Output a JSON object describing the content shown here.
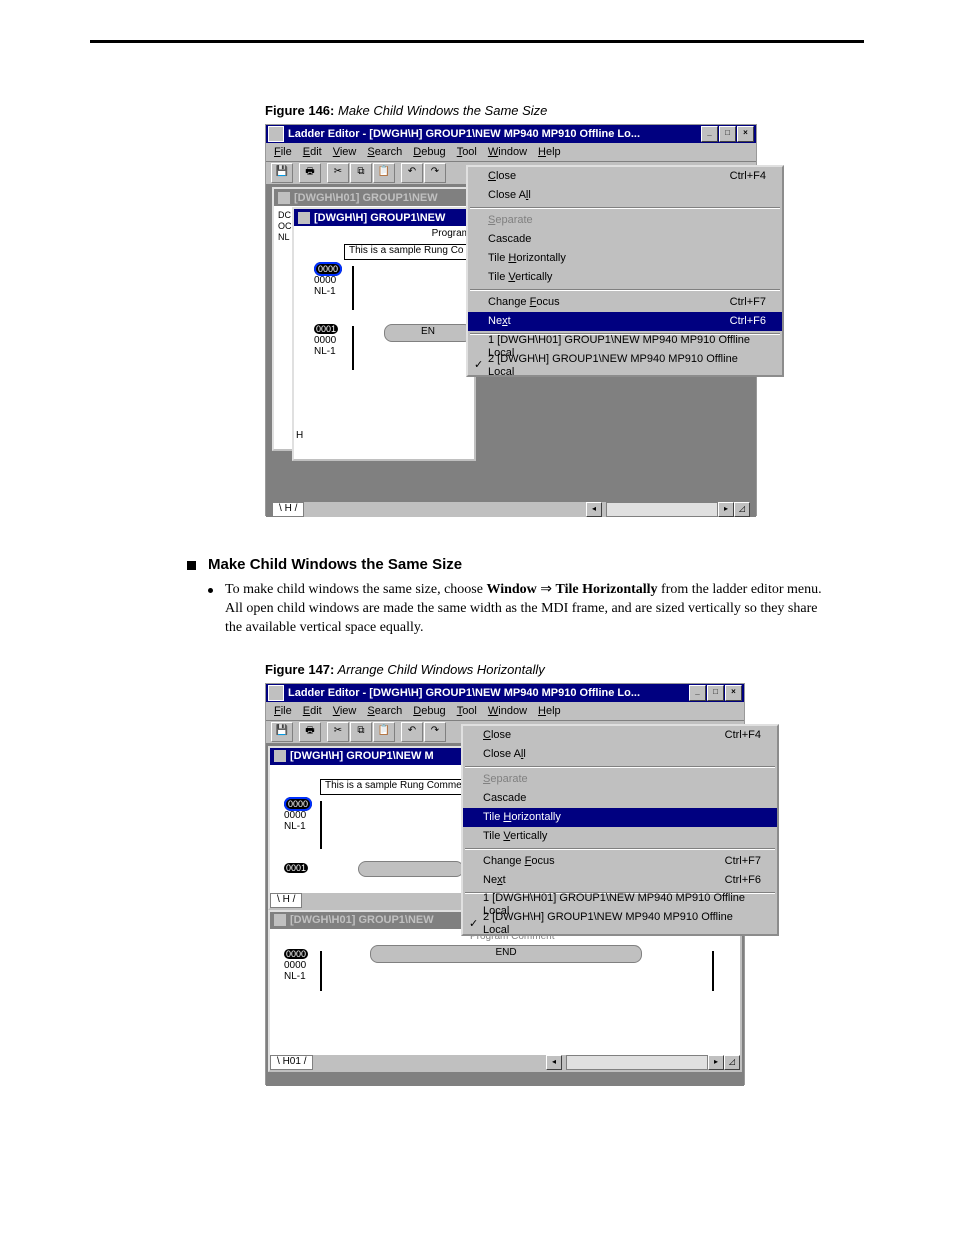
{
  "figA": {
    "label": "Figure 146:",
    "title": "Make Child Windows the Same Size",
    "window_title": "Ladder Editor - [DWGH\\H]   GROUP1\\NEW  MP940  MP910    Offline  Lo...",
    "menus": [
      "File",
      "Edit",
      "View",
      "Search",
      "Debug",
      "Tool",
      "Window",
      "Help"
    ],
    "child1_title": "[DWGH\\H01]   GROUP1\\NEW",
    "child2_title": "[DWGH\\H]   GROUP1\\NEW",
    "program_label": "Program",
    "comment": "This is a sample Rung Co",
    "rung0": {
      "step": "0000",
      "addr": "0000",
      "nl": "NL-1"
    },
    "rung1": {
      "step": "0001",
      "addr": "0000",
      "nl": "NL-1"
    },
    "end": "EN",
    "tabH": "H",
    "menu_items": [
      {
        "t": "Close",
        "sc": "Ctrl+F4"
      },
      {
        "t": "Close All",
        "sc": ""
      },
      {
        "sep": true
      },
      {
        "t": "Separate",
        "sc": "",
        "dis": true
      },
      {
        "t": "Cascade",
        "sc": ""
      },
      {
        "t": "Tile Horizontally",
        "sc": ""
      },
      {
        "t": "Tile Vertically",
        "sc": ""
      },
      {
        "sep": true
      },
      {
        "t": "Change Focus",
        "sc": "Ctrl+F7"
      },
      {
        "t": "Next",
        "sc": "Ctrl+F6",
        "sel": true
      },
      {
        "sep": true
      },
      {
        "t": "1 [DWGH\\H01]   GROUP1\\NEW MP940 MP910   Offline Local",
        "sc": ""
      },
      {
        "t": "2 [DWGH\\H]   GROUP1\\NEW MP940 MP910   Offline Local",
        "sc": "",
        "chk": true
      }
    ]
  },
  "body": {
    "heading": "Make Child Windows the Same Size",
    "text_before": "To make child windows the same size, choose ",
    "bold1": "Window",
    "arrow": " ⇒ ",
    "bold2": "Tile Horizontally",
    "text_after": " from the ladder editor menu. All open child windows are made the same width as the MDI frame, and are sized vertically so they share the available vertical space equally."
  },
  "figB": {
    "label": "Figure 147:",
    "title": "Arrange Child Windows Horizontally",
    "window_title": "Ladder Editor - [DWGH\\H]   GROUP1\\NEW  MP940  MP910    Offline  Lo...",
    "menus": [
      "File",
      "Edit",
      "View",
      "Search",
      "Debug",
      "Tool",
      "Window",
      "Help"
    ],
    "childTop_title": "[DWGH\\H]   GROUP1\\NEW  M",
    "childBot_title": "[DWGH\\H01]   GROUP1\\NEW",
    "comment": "This is a sample Rung Comme",
    "rung0": {
      "step": "0000",
      "addr": "0000",
      "nl": "NL-1"
    },
    "rung1": {
      "step": "0001"
    },
    "tabTop": "H",
    "program_comment": "Program Comment",
    "bot_rung": {
      "step": "0000",
      "addr": "0000",
      "nl": "NL-1"
    },
    "end": "END",
    "tabBot": "H01",
    "menu_items": [
      {
        "t": "Close",
        "sc": "Ctrl+F4"
      },
      {
        "t": "Close All",
        "sc": ""
      },
      {
        "sep": true
      },
      {
        "t": "Separate",
        "sc": "",
        "dis": true
      },
      {
        "t": "Cascade",
        "sc": ""
      },
      {
        "t": "Tile Horizontally",
        "sc": "",
        "sel": true
      },
      {
        "t": "Tile Vertically",
        "sc": ""
      },
      {
        "sep": true
      },
      {
        "t": "Change Focus",
        "sc": "Ctrl+F7"
      },
      {
        "t": "Next",
        "sc": "Ctrl+F6"
      },
      {
        "sep": true
      },
      {
        "t": "1 [DWGH\\H01]   GROUP1\\NEW MP940 MP910   Offline Local",
        "sc": ""
      },
      {
        "t": "2 [DWGH\\H]   GROUP1\\NEW MP940 MP910   Offline Local",
        "sc": "",
        "chk": true
      }
    ]
  }
}
